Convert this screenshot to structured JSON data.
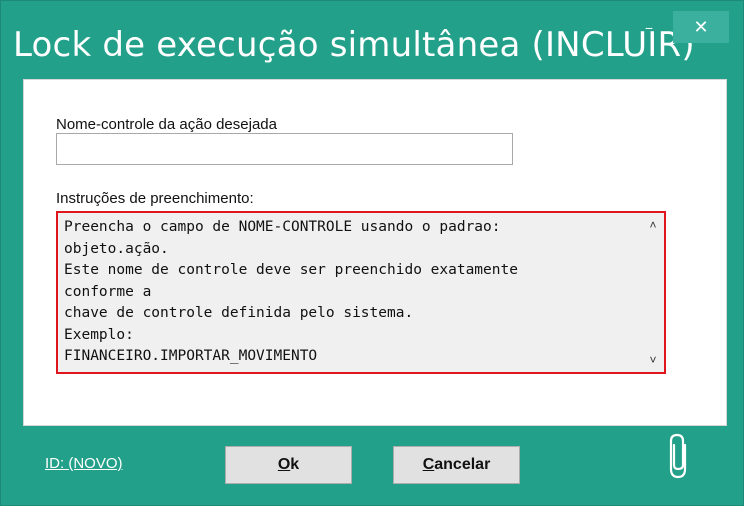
{
  "window": {
    "title": "Lock de execução simultânea (INCLUIR)",
    "minimize_glyph": "−",
    "close_glyph": "✕"
  },
  "form": {
    "name_label": "Nome-controle da ação desejada",
    "name_value": "",
    "instructions_label": "Instruções de preenchimento:",
    "instructions_text": "Preencha o campo de NOME-CONTROLE usando o padrao:\nobjeto.ação.\nEste nome de controle deve ser preenchido exatamente\nconforme a\nchave de controle definida pelo sistema.\nExemplo:\nFINANCEIRO.IMPORTAR_MOVIMENTO",
    "scroll_up_glyph": "˄",
    "scroll_down_glyph": "˅"
  },
  "footer": {
    "id_link": "ID: (NOVO)",
    "ok_hotkey": "O",
    "ok_rest": "k",
    "cancel_hotkey": "C",
    "cancel_rest": "ancelar"
  },
  "colors": {
    "accent": "#22a08a",
    "highlight_border": "#e0161f"
  },
  "icons": [
    "paperclip-icon",
    "minimize-icon",
    "close-icon",
    "chevron-up-icon",
    "chevron-down-icon"
  ]
}
